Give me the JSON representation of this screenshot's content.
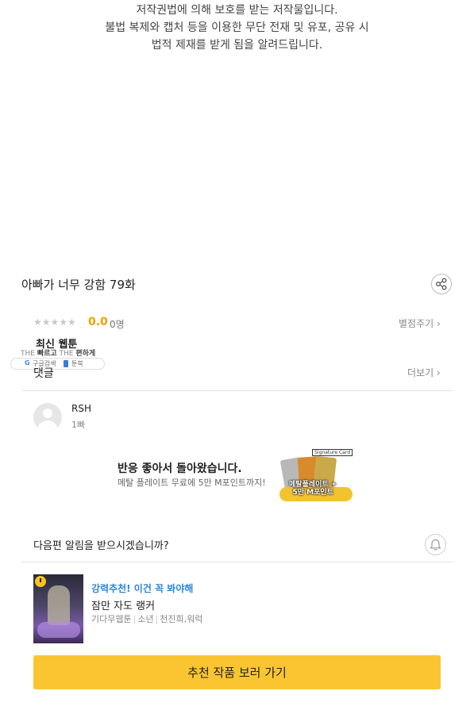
{
  "copyright_notice": [
    "저작권법에 의해 보호를 받는 저작물입니다.",
    "불법 복제와 캡처 등을 이용한 무단 전재 및 유포, 공유 시",
    "법적 제재를 받게 됨을 알려드립니다."
  ],
  "episode": {
    "title": "아빠가 너무 강함 79화",
    "share_icon": "share-icon"
  },
  "rating": {
    "stars": "★★★★★",
    "score": "0.0",
    "count": "0명",
    "rate_link": "별점주기 ›"
  },
  "latest": {
    "heading": "최신 웹툰",
    "promo": {
      "the1": "THE",
      "fast": "빠르고",
      "the2": "THE",
      "easy": "편하게",
      "google_icon": "G",
      "google_label": "구글검색",
      "toon_label": "툰북"
    }
  },
  "comments": {
    "heading": "댓글",
    "more": "더보기 ›",
    "items": [
      {
        "user": "RSH",
        "text": "1빠"
      }
    ]
  },
  "ad": {
    "title": "반응 좋아서 돌아왔습니다.",
    "subtitle": "메탈 플레이트 무료에 5만 M포인트까지!",
    "image_tag": "Signature Card",
    "image_line1": "메탈플레이트 +",
    "image_line2": "5만 M포인트"
  },
  "notification": {
    "question": "다음편 알림을 받으시겠습니까?",
    "icon": "bell-icon"
  },
  "recommendation": {
    "tag": "강력추천! 이건 꼭 봐야해",
    "title": "잠만 자도 랭커",
    "meta": [
      "기다무웹툰",
      "소년",
      "천진희,워럭"
    ]
  },
  "cta": {
    "label": "추천 작품 보러 가기"
  },
  "colors": {
    "accent_yellow": "#fbc531",
    "score_orange": "#f0a000",
    "tag_blue": "#2f86d8"
  }
}
